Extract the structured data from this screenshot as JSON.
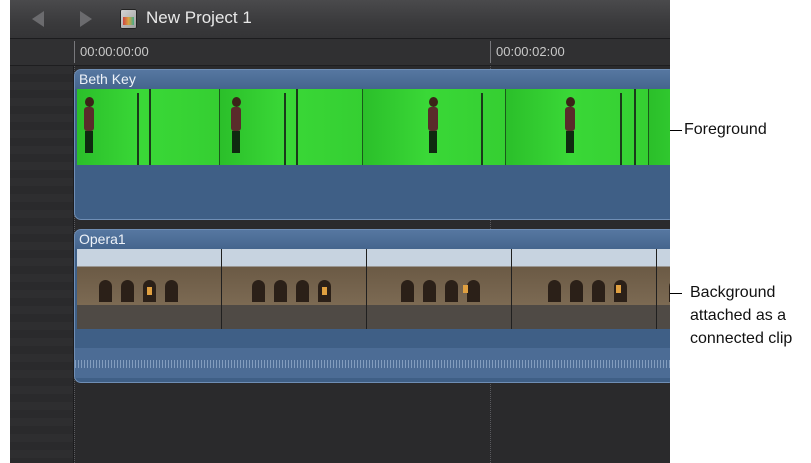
{
  "toolbar": {
    "back_label": "◀",
    "forward_label": "▶",
    "project_title": "New Project 1"
  },
  "ruler": {
    "timecodes": [
      "00:00:00:00",
      "00:00:02:00"
    ]
  },
  "clips": {
    "foreground": {
      "name": "Beth Key"
    },
    "background": {
      "name": "Opera1"
    }
  },
  "callouts": {
    "foreground": "Foreground",
    "background_line1": "Background",
    "background_line2": "attached as a",
    "background_line3": "connected clip"
  },
  "colors": {
    "timeline_bg": "#2a2a2c",
    "clip_blue": "#3f5f86",
    "green_screen": "#35cf32"
  }
}
